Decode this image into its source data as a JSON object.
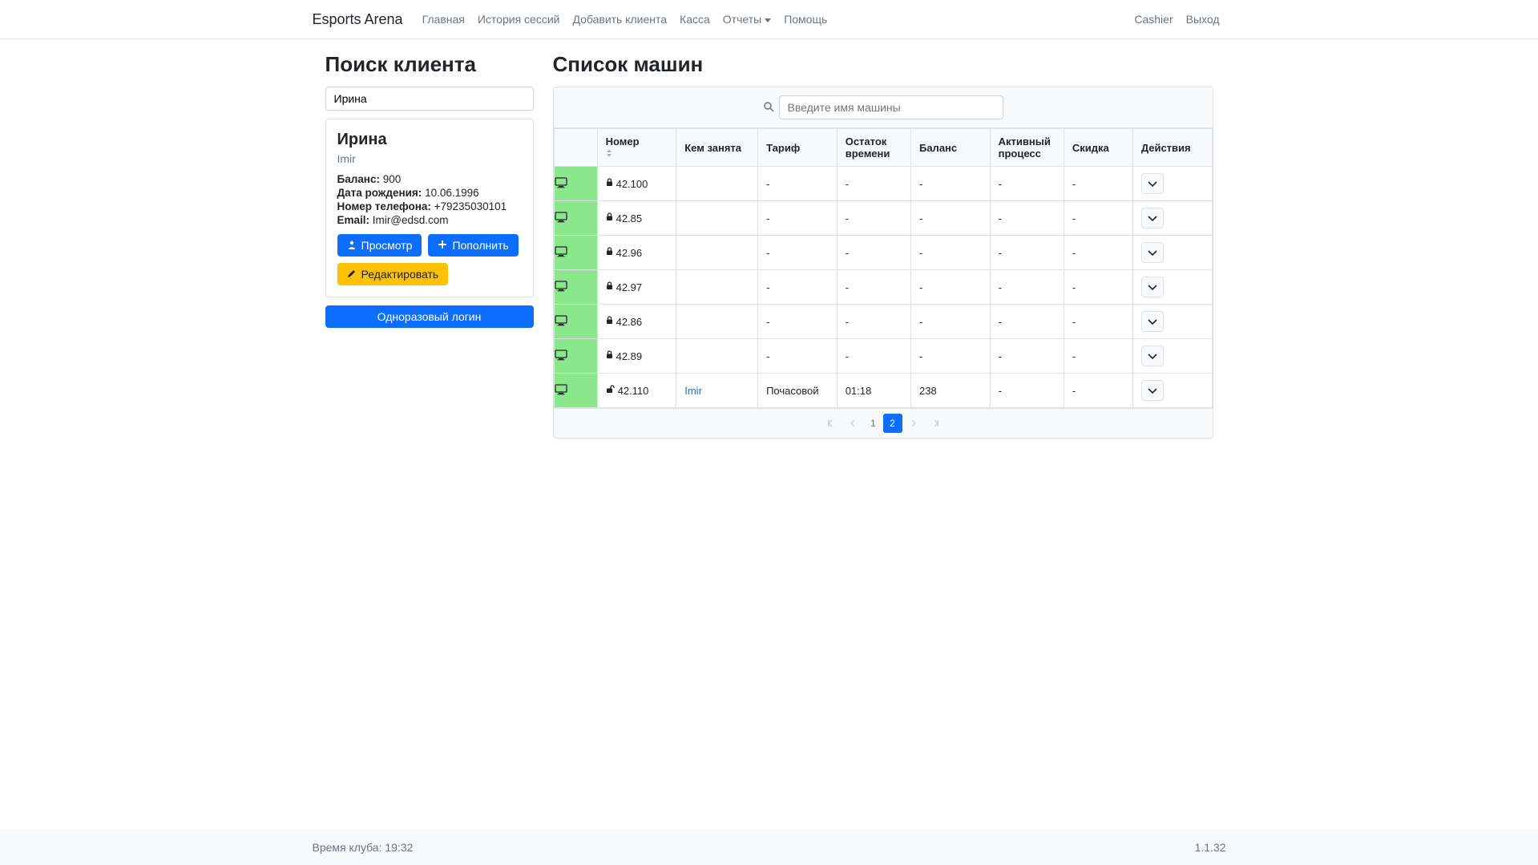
{
  "brand": "Esports Arena",
  "nav": {
    "home": "Главная",
    "history": "История сессий",
    "add_client": "Добавить клиента",
    "cash": "Касса",
    "reports": "Отчеты",
    "help": "Помощь",
    "cashier": "Cashier",
    "logout": "Выход"
  },
  "left": {
    "title": "Поиск клиента",
    "search_value": "Ирина",
    "client": {
      "name": "Ирина",
      "login": "Imir",
      "balance_label": "Баланс:",
      "balance": "900",
      "dob_label": "Дата рождения:",
      "dob": "10.06.1996",
      "phone_label": "Номер телефона:",
      "phone": "+79235030101",
      "email_label": "Email:",
      "email": "Imir@edsd.com"
    },
    "buttons": {
      "view": "Просмотр",
      "topup": "Пополнить",
      "edit": "Редактировать",
      "otp": "Одноразовый логин"
    }
  },
  "right": {
    "title": "Список машин",
    "search_placeholder": "Введите имя машины",
    "headers": {
      "number": "Номер",
      "occupied_by": "Кем занята",
      "tariff": "Тариф",
      "time_left": "Остаток времени",
      "balance": "Баланс",
      "active_proc": "Активный процесс",
      "discount": "Скидка",
      "actions": "Действия"
    },
    "rows": [
      {
        "locked": true,
        "number": "42.100",
        "occupied_by": "",
        "tariff": "-",
        "time_left": "-",
        "balance": "-",
        "active_proc": "-",
        "discount": "-"
      },
      {
        "locked": true,
        "number": "42.85",
        "occupied_by": "",
        "tariff": "-",
        "time_left": "-",
        "balance": "-",
        "active_proc": "-",
        "discount": "-"
      },
      {
        "locked": true,
        "number": "42.96",
        "occupied_by": "",
        "tariff": "-",
        "time_left": "-",
        "balance": "-",
        "active_proc": "-",
        "discount": "-"
      },
      {
        "locked": true,
        "number": "42.97",
        "occupied_by": "",
        "tariff": "-",
        "time_left": "-",
        "balance": "-",
        "active_proc": "-",
        "discount": "-"
      },
      {
        "locked": true,
        "number": "42.86",
        "occupied_by": "",
        "tariff": "-",
        "time_left": "-",
        "balance": "-",
        "active_proc": "-",
        "discount": "-"
      },
      {
        "locked": true,
        "number": "42.89",
        "occupied_by": "",
        "tariff": "-",
        "time_left": "-",
        "balance": "-",
        "active_proc": "-",
        "discount": "-"
      },
      {
        "locked": false,
        "number": "42.110",
        "occupied_by": "Imir",
        "tariff": "Почасовой",
        "time_left": "01:18",
        "balance": "238",
        "active_proc": "-",
        "discount": "-"
      }
    ],
    "pagination": {
      "pages": [
        "1",
        "2"
      ],
      "active": "2"
    }
  },
  "footer": {
    "club_time_label": "Время клуба:",
    "club_time": "19:32",
    "version": "1.1.32"
  }
}
